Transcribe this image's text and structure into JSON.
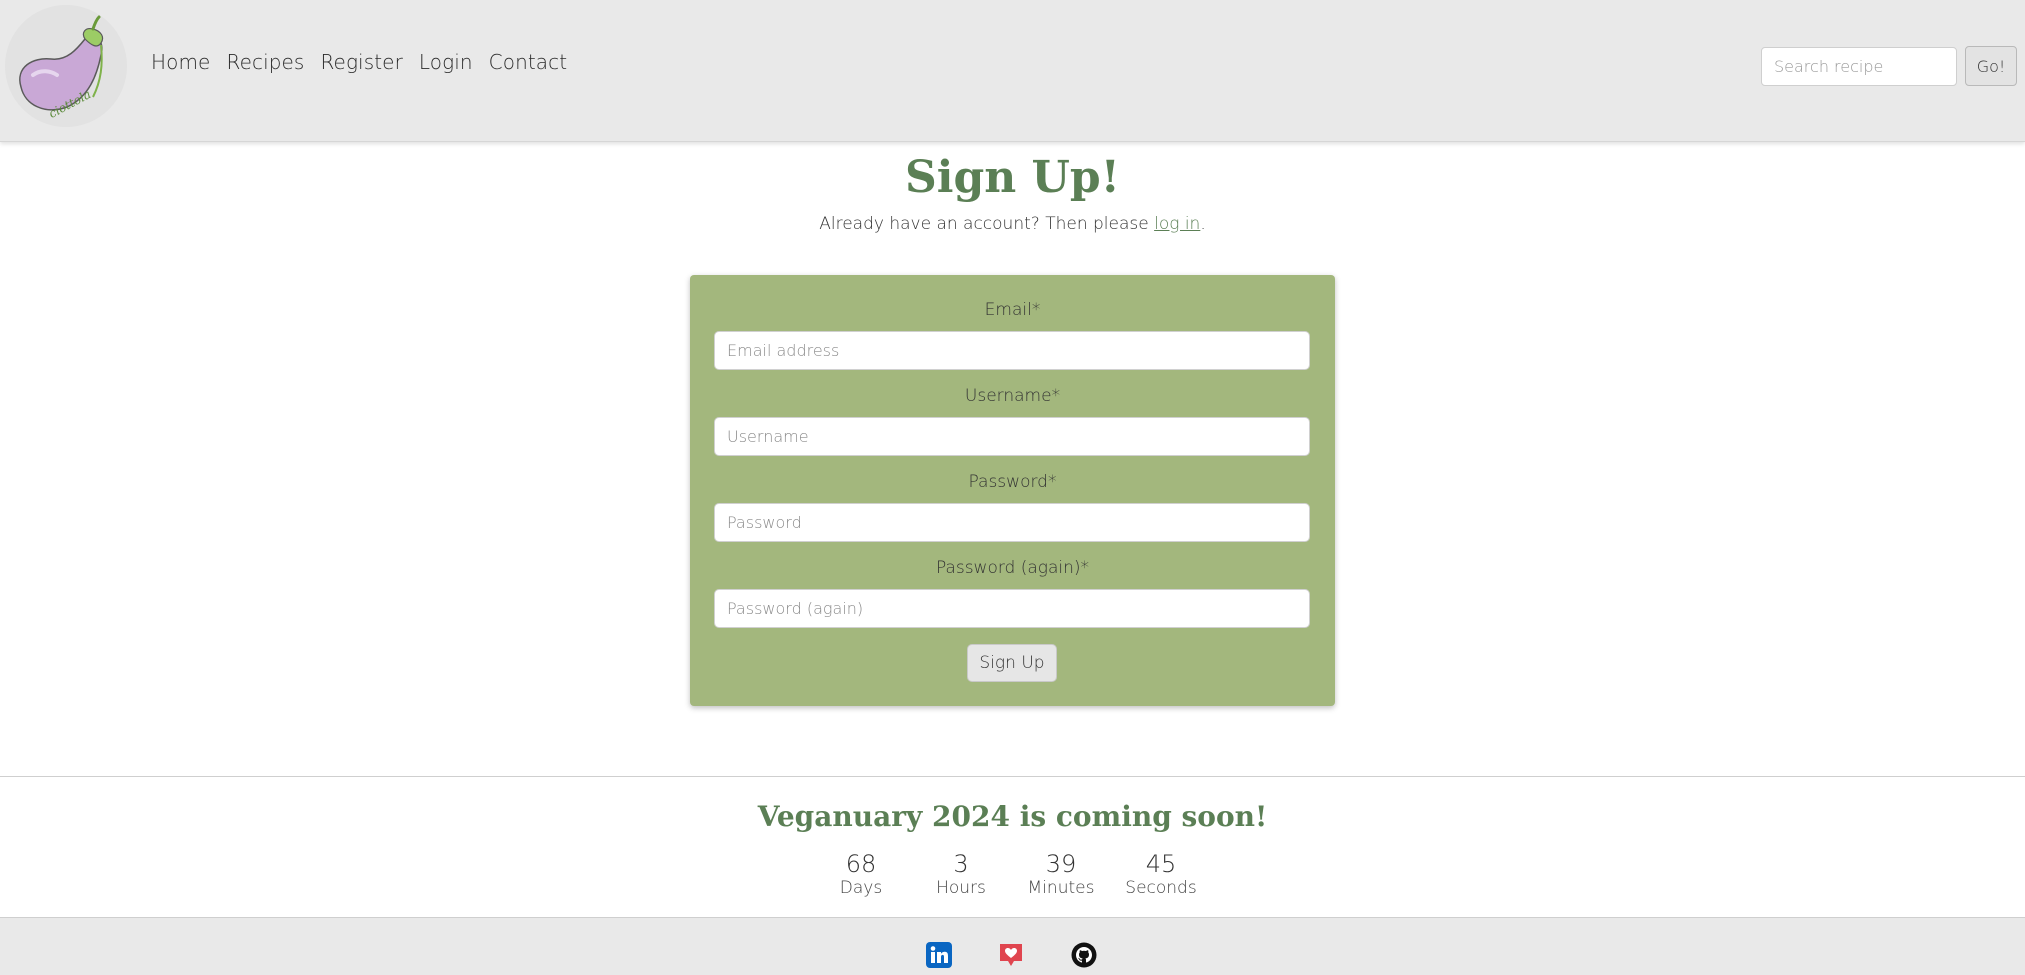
{
  "nav": {
    "logo_text": "ciottola",
    "links": [
      "Home",
      "Recipes",
      "Register",
      "Login",
      "Contact"
    ],
    "search_placeholder": "Search recipe",
    "search_button": "Go!"
  },
  "main": {
    "title": "Sign Up!",
    "subtitle_prefix": "Already have an account? Then please ",
    "subtitle_link": "log in",
    "subtitle_suffix": "."
  },
  "form": {
    "fields": [
      {
        "label": "Email*",
        "placeholder": "Email address"
      },
      {
        "label": "Username*",
        "placeholder": "Username"
      },
      {
        "label": "Password*",
        "placeholder": "Password"
      },
      {
        "label": "Password (again)*",
        "placeholder": "Password (again)"
      }
    ],
    "submit": "Sign Up",
    "card_color": "#a3b77d"
  },
  "countdown": {
    "title": "Veganuary 2024 is coming soon!",
    "units": [
      {
        "value": "68",
        "label": "Days"
      },
      {
        "value": "3",
        "label": "Hours"
      },
      {
        "value": "39",
        "label": "Minutes"
      },
      {
        "value": "45",
        "label": "Seconds"
      }
    ]
  },
  "footer": {
    "icons": [
      "linkedin-icon",
      "heart-chat-icon",
      "github-icon"
    ]
  },
  "colors": {
    "accent": "#5b7f55",
    "nav_bg": "#e9e9e9",
    "linkedin": "#0a66c2",
    "heart": "#e0454f"
  }
}
